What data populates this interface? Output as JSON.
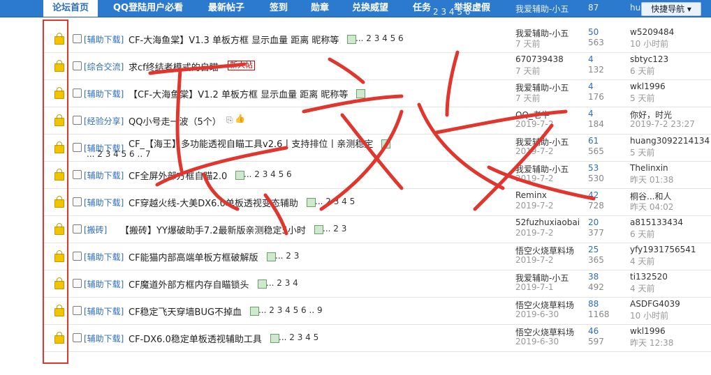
{
  "nav": {
    "items": [
      "论坛首页",
      "QQ登陆用户必看",
      "最新帖子",
      "签到",
      "勋章",
      "兑换威望",
      "任务",
      "举报虚假"
    ],
    "quick_nav": "快捷导航",
    "partial_row": {
      "pages": "2 3 4 5 6",
      "author": "我爱辅助-小五",
      "replies": "87",
      "last_user": "hua"
    }
  },
  "threads": [
    {
      "category": "[辅助下载]",
      "title": "CF-大海鱼棠】V1.3 单板方框 显示血量 距离 昵称等",
      "pages": "... 2 3 4 5 6",
      "author": "我爱辅助-小五",
      "date": "7 天前",
      "replies": "50",
      "views": "563",
      "last_user": "w5209484",
      "last_time": "10 小时前"
    },
    {
      "category": "[综合交流]",
      "title": "求cf终结者模式的自瞄",
      "badge": "新人帖",
      "author": "670739438",
      "date": "7 天前",
      "replies": "4",
      "views": "132",
      "last_user": "sbtyc123",
      "last_time": "6 天前"
    },
    {
      "category": "[辅助下载]",
      "title": "【CF-大海鱼棠】V1.2 单板方框 显示血量 距离 昵称等",
      "pages": "",
      "author": "我爱辅助-小五",
      "date": "7 天前",
      "replies": "4",
      "views": "176",
      "last_user": "wkl1996",
      "last_time": "5 天前"
    },
    {
      "category": "[经验分享]",
      "title": "QQ小号走一波（5个）",
      "pages": "",
      "author": "QQ_老牛",
      "date": "2019-7-2",
      "replies": "4",
      "views": "184",
      "last_user": "你好，时光",
      "last_time": "2019-7-2 23:27"
    },
    {
      "category": "[辅助下载]",
      "title": "CF_【海王】多功能透视自瞄工具v2.6丨支持排位丨亲测稳定",
      "pages": "... 2 3 4 5 6 .. 7",
      "author": "我爱辅助-小五",
      "date": "2019-7-2",
      "replies": "61",
      "views": "565",
      "last_user": "huang3092214134",
      "last_time": "5 天前"
    },
    {
      "category": "[辅助下载]",
      "title": "CF全屏外部方框自瞄2.0",
      "pages": "... 2 3 4 5 6",
      "author": "我爱辅助-小五",
      "date": "2019-7-2",
      "replies": "53",
      "views": "530",
      "last_user": "Thelinxin",
      "last_time": "昨天 01:38"
    },
    {
      "category": "[辅助下载]",
      "title": "CF穿越火线-大美DX6.0单板透视变态辅助",
      "pages": "... 2 3 4 5",
      "author": "Reminx",
      "date": "2019-7-2",
      "replies": "42",
      "views": "728",
      "last_user": "桐谷...和人",
      "last_time": "昨天 04:02"
    },
    {
      "category": "[搬砖]",
      "title": "【搬砖】YY爆破助手7.2最新版亲测稳定5小时",
      "pages": "... 2 3",
      "author": "52fuzhuxiaobai",
      "date": "2019-7-2",
      "replies": "20",
      "views": "377",
      "last_user": "a815133434",
      "last_time": "6 天前"
    },
    {
      "category": "[辅助下载]",
      "title": "CF能猫内部高端单板方框破解版",
      "pages": "... 2 3",
      "author": "悟空火烧草料场",
      "date": "2019-7-2",
      "replies": "25",
      "views": "365",
      "last_user": "yfy1931756541",
      "last_time": "4 天前"
    },
    {
      "category": "[辅助下载]",
      "title": "CF魔道外部方框内存自瞄锁头",
      "pages": "... 2 3 4",
      "author": "我爱辅助-小五",
      "date": "2019-7-1",
      "replies": "38",
      "views": "492",
      "last_user": "ti132520",
      "last_time": "4 天前"
    },
    {
      "category": "[辅助下载]",
      "title": "CF稳定飞天穿墙BUG不掉血",
      "pages": "... 2 3 4 5 6 .. 9",
      "author": "悟空火烧草料场",
      "date": "2019-6-30",
      "replies": "88",
      "views": "1168",
      "last_user": "ASDFG4039",
      "last_time": "10 小时前"
    },
    {
      "category": "[辅助下载]",
      "title": "CF-DX6.0稳定单板透视辅助工具",
      "pages": "... 2 3 4 5",
      "author": "悟空火烧草料场",
      "date": "2019-6-30",
      "replies": "46",
      "views": "597",
      "last_user": "wkl1996",
      "last_time": "昨天 12:38"
    }
  ],
  "colors": {
    "nav_bg": "#2b7acd",
    "link": "#2f6ebb",
    "annotation_red": "#e0362e"
  }
}
